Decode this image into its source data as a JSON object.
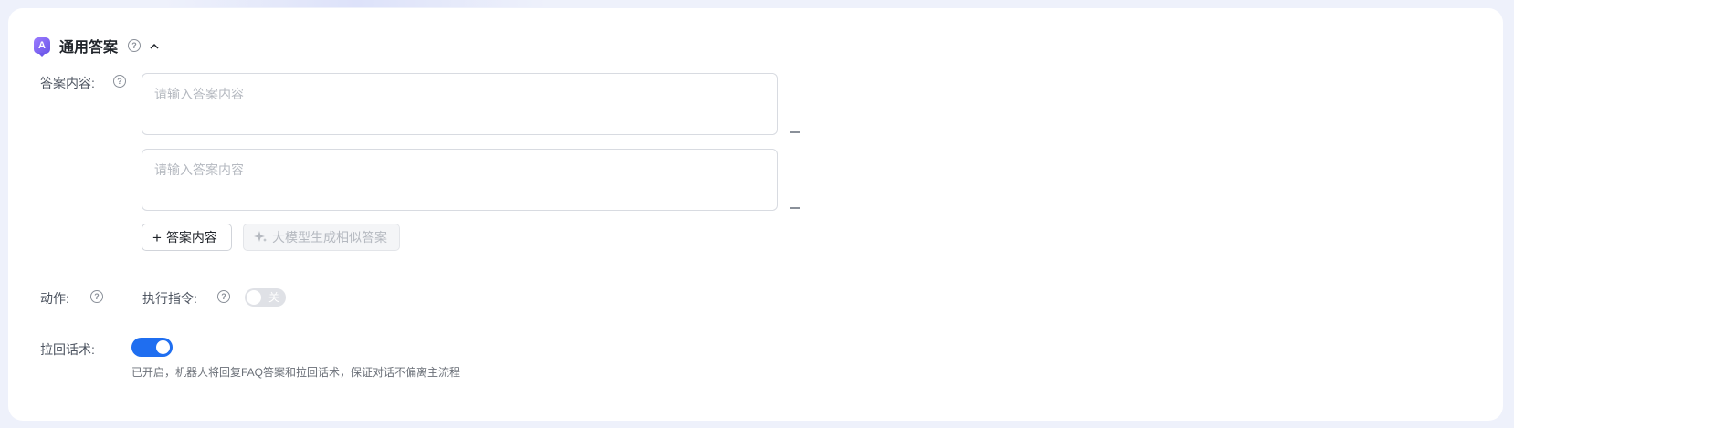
{
  "section": {
    "badge_letter": "A",
    "title": "通用答案"
  },
  "answer": {
    "label": "答案内容:",
    "items": [
      {
        "value": "",
        "placeholder": "请输入答案内容"
      },
      {
        "value": "",
        "placeholder": "请输入答案内容"
      }
    ],
    "add_label": "答案内容",
    "ai_label": "大模型生成相似答案"
  },
  "action": {
    "label": "动作:",
    "exec_label": "执行指令:",
    "toggle_state": "关",
    "enabled": false
  },
  "pullback": {
    "label": "拉回话术:",
    "enabled": true,
    "hint": "已开启，机器人将回复FAQ答案和拉回话术，保证对话不偏离主流程"
  },
  "colors": {
    "accent": "#1f6ef0",
    "badge": "#7b63f0",
    "toggle_off": "#dfe1e6"
  },
  "icons": {
    "title_help": "question-circle-icon",
    "collapse": "chevron-up-icon",
    "add": "plus-icon",
    "ai": "sparkle-icon",
    "remove": "minus-icon"
  }
}
